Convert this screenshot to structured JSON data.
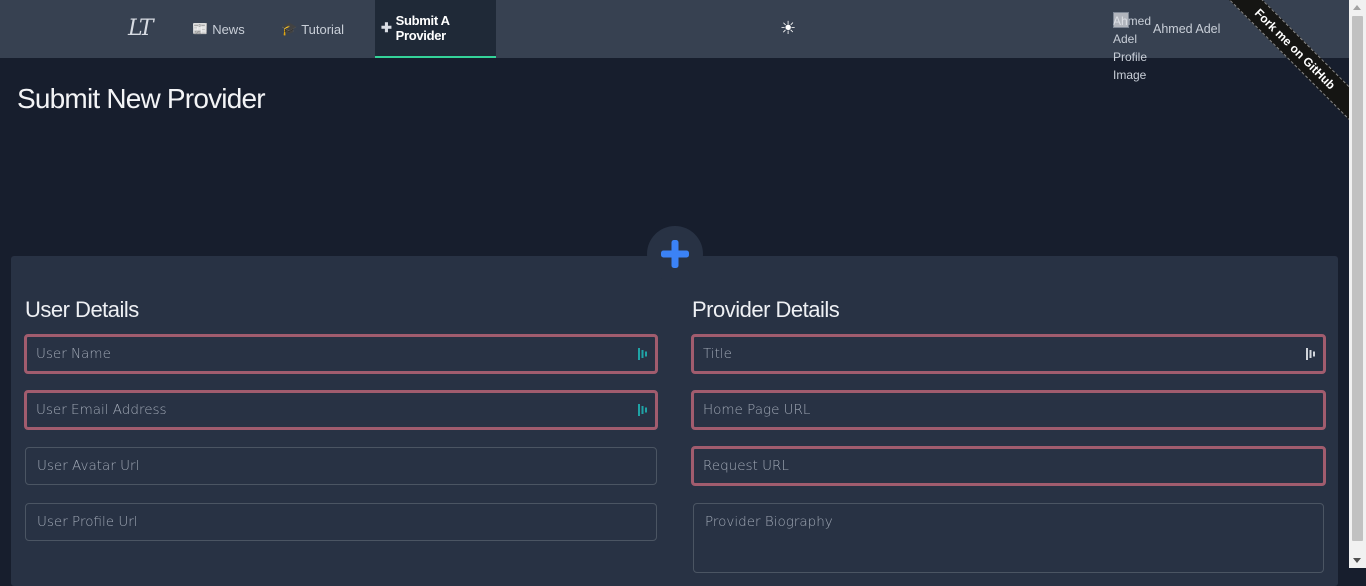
{
  "nav": {
    "logo": "LT",
    "items": [
      {
        "label": "News",
        "icon": "📰"
      },
      {
        "label": "Tutorial",
        "icon": "🎓"
      },
      {
        "label": "Submit A Provider",
        "icon": "✚"
      }
    ],
    "theme_toggle": "☀",
    "profile_image_alt": "Ahmed Adel Profile Image",
    "profile_name": "Ahmed Adel"
  },
  "ribbon": {
    "label": "Fork me on GitHub"
  },
  "page": {
    "title": "Submit New Provider"
  },
  "form": {
    "user_section_title": "User Details",
    "provider_section_title": "Provider Details",
    "user_fields": [
      {
        "placeholder": "User Name",
        "invalid": true
      },
      {
        "placeholder": "User Email Address",
        "invalid": true
      },
      {
        "placeholder": "User Avatar Url",
        "invalid": false
      },
      {
        "placeholder": "User Profile Url",
        "invalid": false
      }
    ],
    "provider_fields": [
      {
        "placeholder": "Title",
        "invalid": true
      },
      {
        "placeholder": "Home Page URL",
        "invalid": true
      },
      {
        "placeholder": "Request URL",
        "invalid": true
      },
      {
        "placeholder": "Provider Biography",
        "invalid": false
      }
    ]
  },
  "colors": {
    "background": "#171e2d",
    "navbar": "#374151",
    "card": "#283244",
    "invalid_border": "#a15c6e",
    "accent_plus": "#3b82f6",
    "active_underline": "#34d399"
  }
}
